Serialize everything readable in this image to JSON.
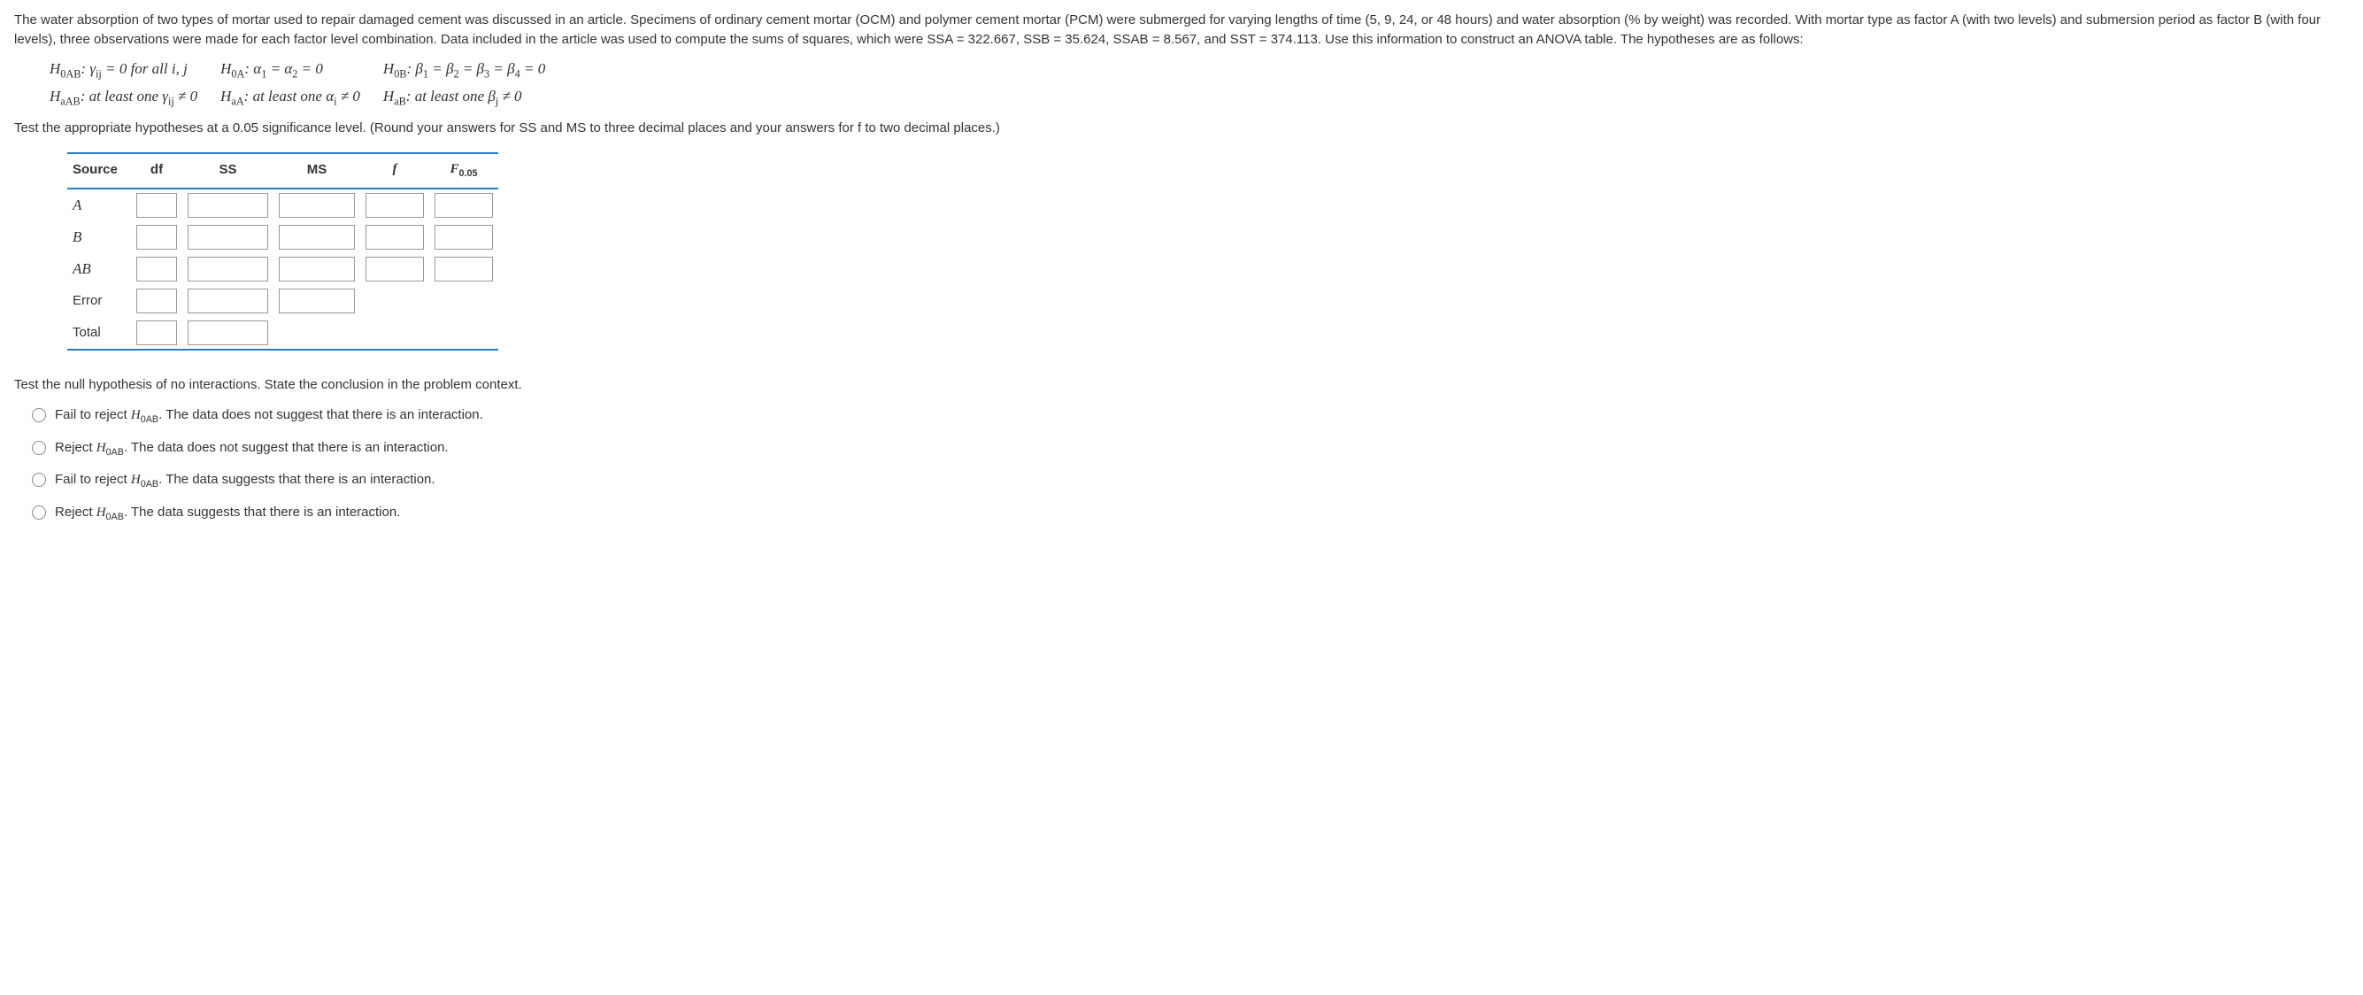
{
  "q_text": "The water absorption of two types of mortar used to repair damaged cement was discussed in an article. Specimens of ordinary cement mortar (OCM) and polymer cement mortar (PCM) were submerged for varying lengths of time (5, 9, 24, or 48 hours) and water absorption (% by weight) was recorded. With mortar type as factor A (with two levels) and submersion period as factor B (with four levels), three observations were made for each factor level combination. Data included in the article was used to compute the sums of squares, which were SSA = 322.667, SSB = 35.624, SSAB = 8.567, and SST = 374.113. Use this information to construct an ANOVA table. The hypotheses are as follows:",
  "instr": "Test the appropriate hypotheses at a 0.05 significance level. (Round your answers for SS and MS to three decimal places and your answers for f to two decimal places.)",
  "hyps": {
    "h0ab": "H0AB: γij = 0 for all i, j",
    "haab": "HaAB: at least one γij ≠ 0",
    "h0a": "H0A: α1 = α2 = 0",
    "haa": "HaA: at least one αi ≠ 0",
    "h0b": "H0B: β1 = β2 = β3 = β4 = 0",
    "hab": "HaB: at least one βj ≠ 0"
  },
  "anova": {
    "headers": {
      "source": "Source",
      "df": "df",
      "ss": "SS",
      "ms": "MS",
      "f": "f",
      "fcrit": "F0.05"
    },
    "rows": [
      {
        "label": "A",
        "italic": true
      },
      {
        "label": "B",
        "italic": true
      },
      {
        "label": "AB",
        "italic": true
      },
      {
        "label": "Error",
        "italic": false
      },
      {
        "label": "Total",
        "italic": false
      }
    ]
  },
  "mc_q": "Test the null hypothesis of no interactions. State the conclusion in the problem context.",
  "options": [
    "Fail to reject H0AB. The data does not suggest that there is an interaction.",
    "Reject H0AB. The data does not suggest that there is an interaction.",
    "Fail to reject H0AB. The data suggests that there is an interaction.",
    "Reject H0AB. The data suggests that there is an interaction."
  ]
}
